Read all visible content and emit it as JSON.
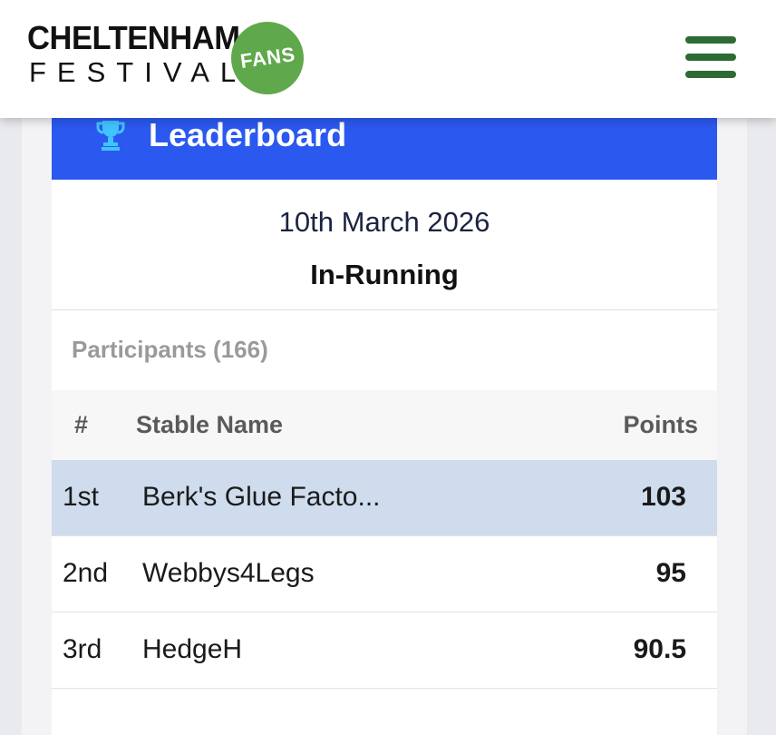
{
  "header": {
    "logo_line1": "CHELTENHAM",
    "logo_line2": "FESTIVAL",
    "logo_badge": "FANS",
    "menu_icon": "hamburger-menu-icon",
    "brand_green": "#2e6b34",
    "badge_green": "#5fa84b"
  },
  "leaderboard": {
    "icon": "trophy-icon",
    "title": "Leaderboard",
    "header_color": "#2b59f0",
    "date": "10th March 2026",
    "status": "In-Running",
    "participants_label": "Participants (166)",
    "columns": {
      "rank": "#",
      "name": "Stable Name",
      "points": "Points"
    },
    "rows": [
      {
        "rank": "1st",
        "name": "Berk's Glue Facto...",
        "points": "103",
        "highlighted": true
      },
      {
        "rank": "2nd",
        "name": "Webbys4Legs",
        "points": "95",
        "highlighted": false
      },
      {
        "rank": "3rd",
        "name": "HedgeH",
        "points": "90.5",
        "highlighted": false
      }
    ],
    "highlight_color": "#cfdcee"
  }
}
